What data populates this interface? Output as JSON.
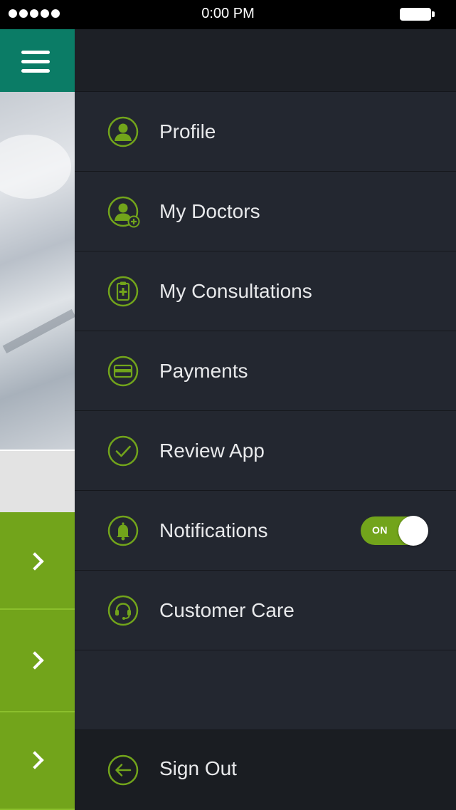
{
  "status_bar": {
    "time": "0:00 PM"
  },
  "menu": {
    "items": [
      {
        "label": "Profile",
        "icon": "user-icon"
      },
      {
        "label": "My Doctors",
        "icon": "add-doctor-icon"
      },
      {
        "label": "My Consultations",
        "icon": "clipboard-medical-icon"
      },
      {
        "label": "Payments",
        "icon": "credit-card-icon"
      },
      {
        "label": "Review App",
        "icon": "checkmark-icon"
      },
      {
        "label": "Notifications",
        "icon": "bell-icon",
        "toggle": "ON"
      },
      {
        "label": "Customer Care",
        "icon": "headset-icon"
      }
    ],
    "sign_out": {
      "label": "Sign Out",
      "icon": "arrow-left-icon"
    }
  },
  "colors": {
    "accent": "#72a41b",
    "header_teal": "#0b7c66",
    "drawer_bg": "#232730"
  }
}
